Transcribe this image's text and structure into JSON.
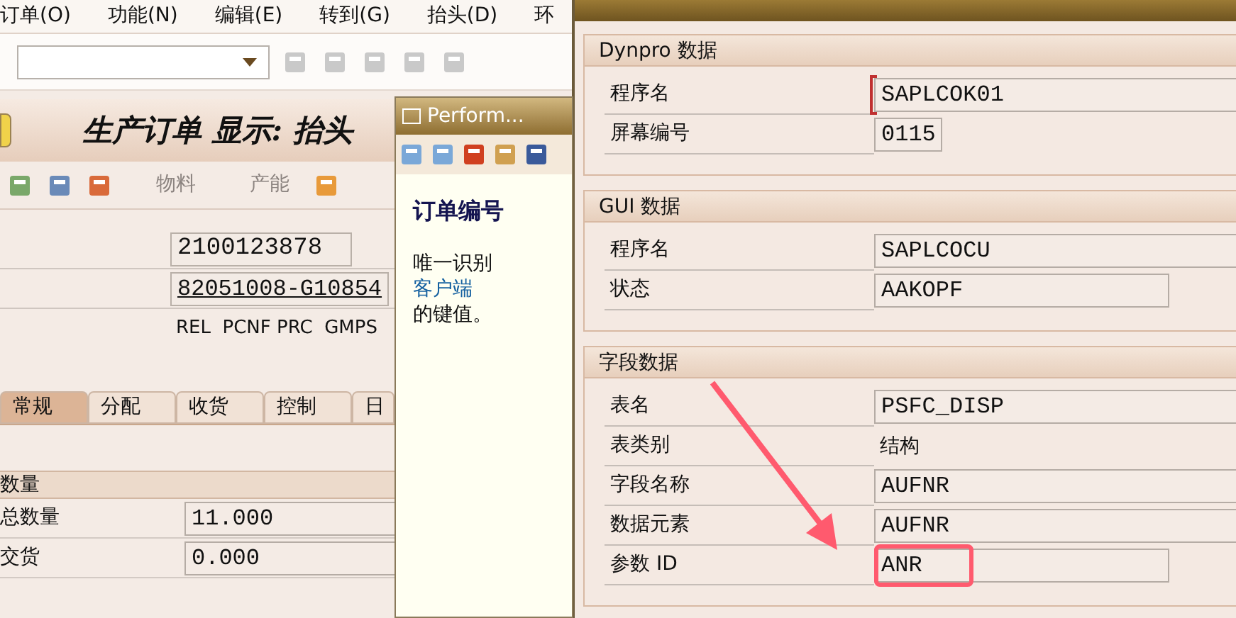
{
  "menu": [
    "订单(O)",
    "功能(N)",
    "编辑(E)",
    "转到(G)",
    "抬头(D)",
    "环"
  ],
  "main": {
    "title": "生产订单 显示: 抬头",
    "app_toolbar": [
      "物料",
      "产能"
    ],
    "header_fields": [
      {
        "kind": "field",
        "value": "2100123878"
      },
      {
        "kind": "link-field",
        "value": "82051008-G10854"
      },
      {
        "kind": "text",
        "value": "REL  PCNF PRC  GMPS"
      }
    ],
    "tabs": [
      {
        "label": "常规",
        "selected": true
      },
      {
        "label": "分配",
        "selected": false
      },
      {
        "label": "收货",
        "selected": false
      },
      {
        "label": "控制",
        "selected": false
      },
      {
        "label": "日",
        "selected": false
      }
    ],
    "quantity": {
      "title": "数量",
      "rows": [
        {
          "label": "总数量",
          "value": "11.000"
        },
        {
          "label": "交货",
          "value": "0.000"
        }
      ]
    }
  },
  "help": {
    "title": "Perform...",
    "heading": "订单编号",
    "text": "唯一识别 ",
    "link": "客户端",
    "text2": "的键值。"
  },
  "tech": {
    "groups": [
      {
        "title": "Dynpro 数据",
        "rows": [
          {
            "label": "程序名",
            "value": "SAPLCOK01",
            "kind": "long-field",
            "focused": true,
            "highlighted": false
          },
          {
            "label": "屏幕编号",
            "value": "0115",
            "kind": "tiny-field",
            "focused": false,
            "highlighted": false
          }
        ]
      },
      {
        "title": "GUI 数据",
        "rows": [
          {
            "label": "程序名",
            "value": "SAPLCOCU",
            "kind": "long-field",
            "focused": false,
            "highlighted": false
          },
          {
            "label": "状态",
            "value": "AAKOPF",
            "kind": "short-field",
            "focused": false,
            "highlighted": false
          }
        ]
      },
      {
        "title": "字段数据",
        "rows": [
          {
            "label": "表名",
            "value": "PSFC_DISP",
            "kind": "long-field",
            "focused": false,
            "highlighted": false
          },
          {
            "label": "表类别",
            "value": "结构",
            "kind": "text",
            "focused": false,
            "highlighted": false
          },
          {
            "label": "字段名称",
            "value": "AUFNR",
            "kind": "long-field",
            "focused": false,
            "highlighted": false
          },
          {
            "label": "数据元素",
            "value": "AUFNR",
            "kind": "long-field",
            "focused": false,
            "highlighted": false
          },
          {
            "label": "参数 ID",
            "value": "ANR",
            "kind": "short-field",
            "focused": false,
            "highlighted": true
          }
        ]
      }
    ]
  }
}
